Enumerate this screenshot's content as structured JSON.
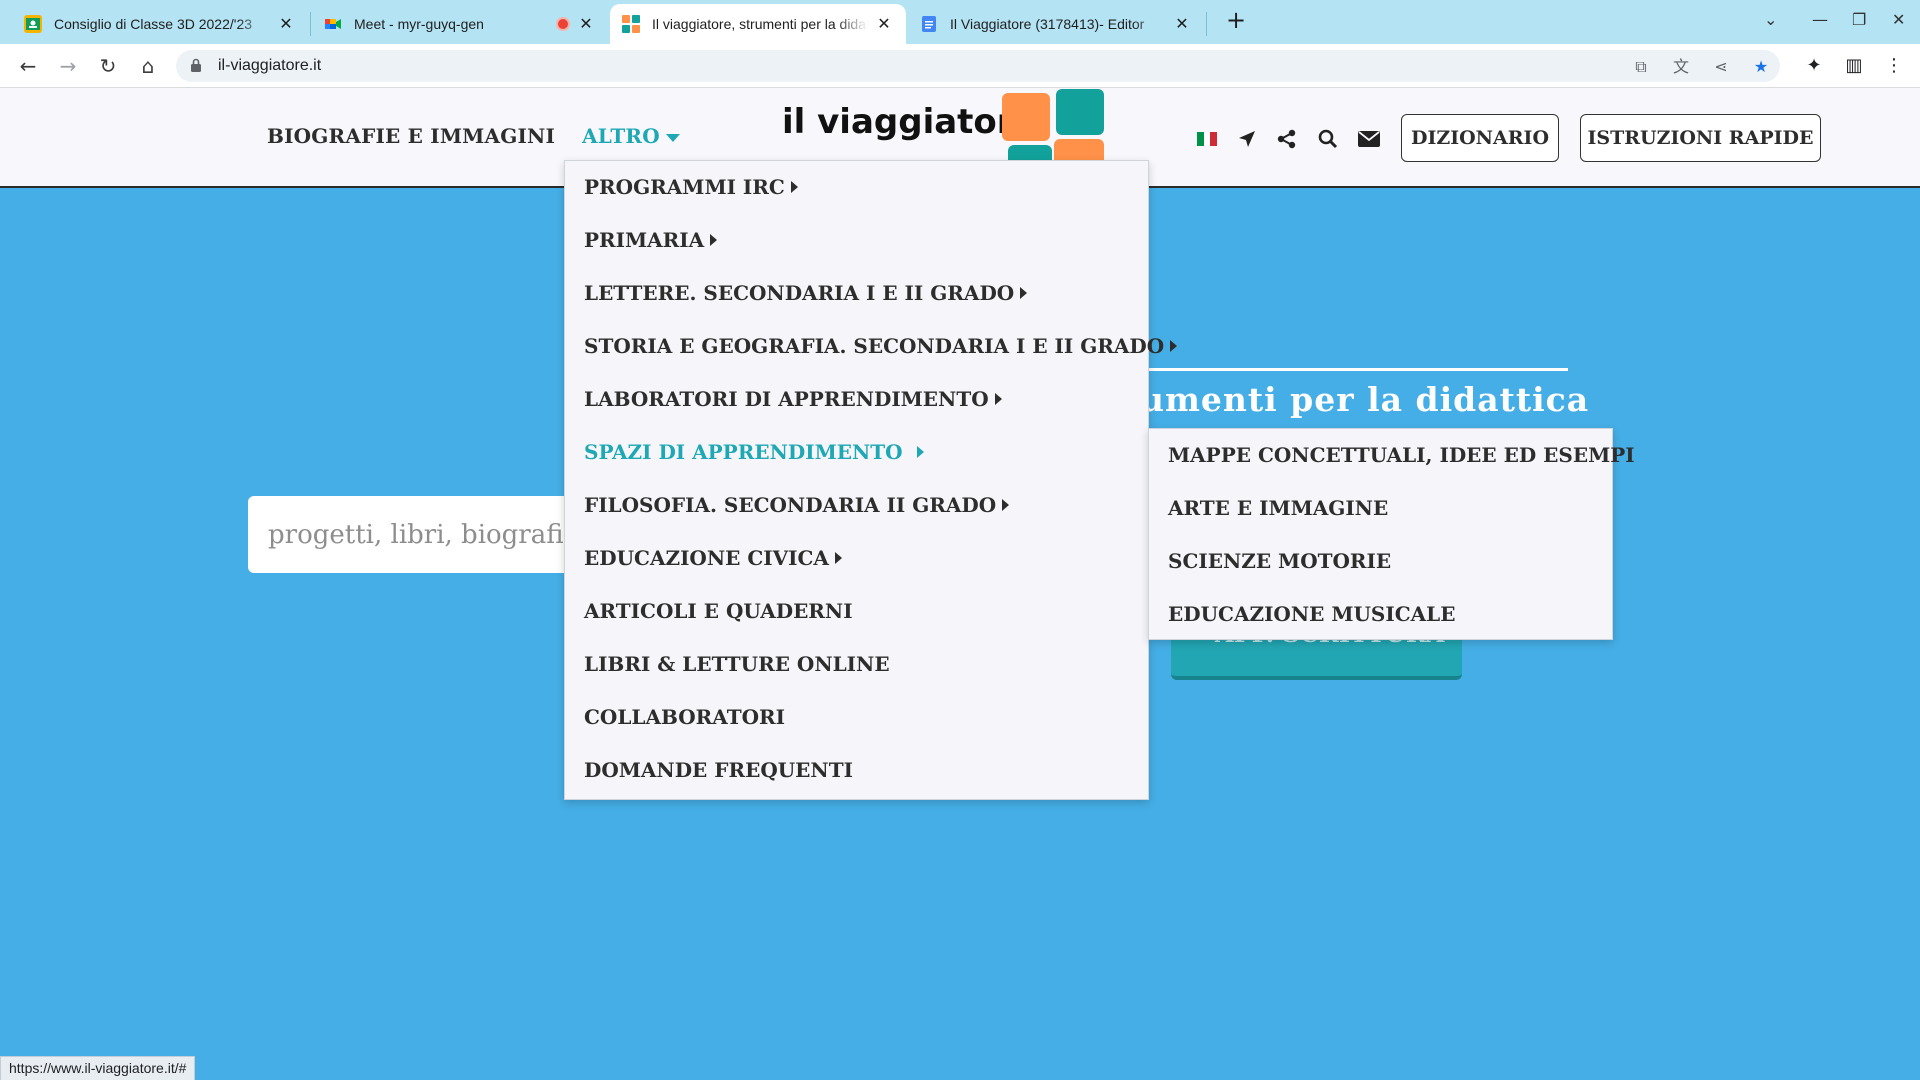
{
  "browser": {
    "tabs": [
      {
        "title": "Consiglio di Classe 3D 2022/'23",
        "favicon": "classroom-icon"
      },
      {
        "title": "Meet - myr-guyq-gen",
        "favicon": "meet-icon",
        "recording": true
      },
      {
        "title": "Il viaggiatore, strumenti per la didattica",
        "favicon": "viaggiatore-icon",
        "active": true
      },
      {
        "title": "Il Viaggiatore (3178413)- Editor",
        "favicon": "docs-icon"
      }
    ],
    "url": "il-viaggiatore.it",
    "status_url": "https://www.il-viaggiatore.it/#"
  },
  "header": {
    "nav": {
      "biografie": "BIOGRAFIE E IMMAGINI",
      "altro": "ALTRO"
    },
    "brand": "il viaggiatore",
    "buttons": {
      "dizionario": "DIZIONARIO",
      "istruzioni": "ISTRUZIONI RAPIDE"
    },
    "icons": [
      "italian-flag-icon",
      "location-arrow-icon",
      "share-icon",
      "search-icon",
      "envelope-icon"
    ]
  },
  "dropdown": {
    "items": [
      {
        "label": "PROGRAMMI IRC",
        "has_sub": true
      },
      {
        "label": "PRIMARIA",
        "has_sub": true
      },
      {
        "label": "LETTERE. SECONDARIA I E II GRADO",
        "has_sub": true
      },
      {
        "label": "STORIA E GEOGRAFIA. SECONDARIA I E II GRADO",
        "has_sub": true
      },
      {
        "label": "LABORATORI DI APPRENDIMENTO",
        "has_sub": true
      },
      {
        "label": "SPAZI DI APPRENDIMENTO",
        "has_sub": true,
        "active": true
      },
      {
        "label": "FILOSOFIA. SECONDARIA II GRADO",
        "has_sub": true
      },
      {
        "label": "EDUCAZIONE CIVICA",
        "has_sub": true
      },
      {
        "label": "ARTICOLI E QUADERNI",
        "has_sub": false
      },
      {
        "label": "LIBRI & LETTURE ONLINE",
        "has_sub": false
      },
      {
        "label": "COLLABORATORI",
        "has_sub": false
      },
      {
        "label": "DOMANDE FREQUENTI",
        "has_sub": false
      }
    ],
    "submenu": [
      "MAPPE CONCETTUALI, IDEE ED ESEMPI",
      "ARTE E IMMAGINE",
      "SCIENZE MOTORIE",
      "EDUCAZIONE MUSICALE"
    ]
  },
  "hero": {
    "title_visible": "umenti  per  la  didattica",
    "search_placeholder": "progetti, libri, biografie,",
    "button_visible": "APP. SCRITTURA"
  },
  "colors": {
    "page_bg": "#45aee6",
    "accent": "#1ea7b4",
    "logo_orange": "#ff9148",
    "logo_teal": "#12a29b"
  }
}
